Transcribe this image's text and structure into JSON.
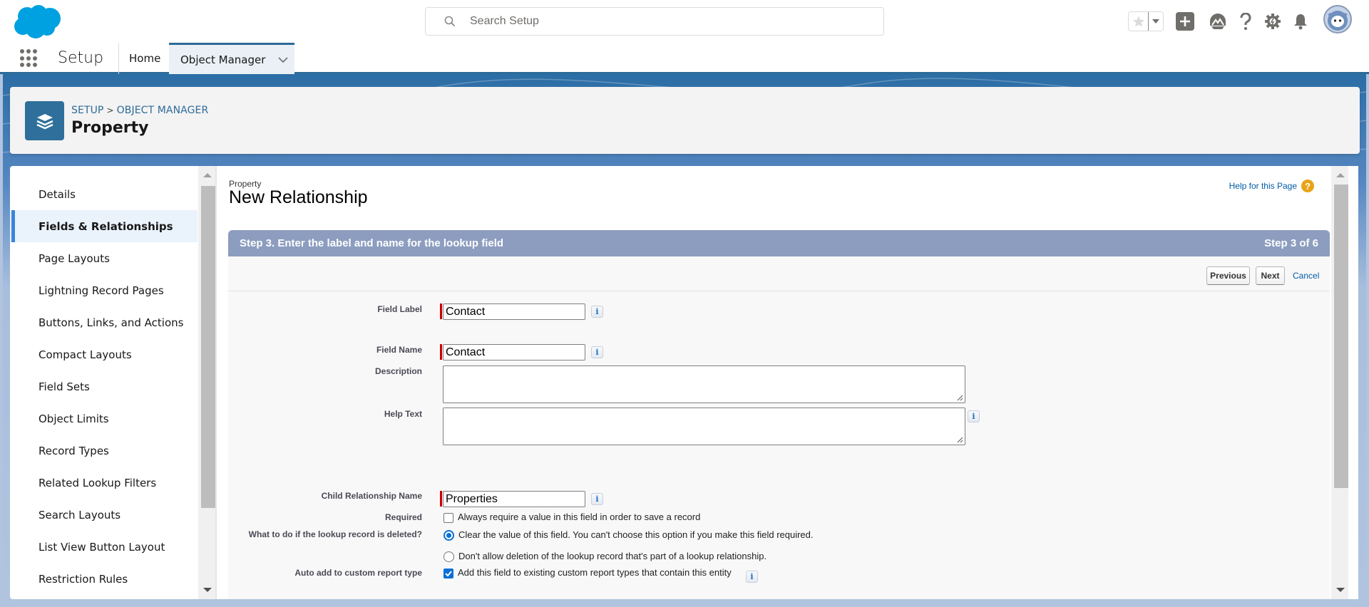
{
  "header": {
    "search_placeholder": "Search Setup",
    "icons": [
      "favorites-star-icon",
      "favorites-dropdown-icon",
      "global-actions-add-icon",
      "trailhead-icon",
      "help-icon",
      "setup-gear-icon",
      "notifications-bell-icon",
      "user-avatar"
    ]
  },
  "nav": {
    "app_name": "Setup",
    "tabs": [
      {
        "label": "Home",
        "active": false
      },
      {
        "label": "Object Manager",
        "active": true
      }
    ]
  },
  "object_header": {
    "breadcrumb": [
      "SETUP",
      "OBJECT MANAGER"
    ],
    "breadcrumb_separator": ">",
    "title": "Property",
    "icon": "layers-icon"
  },
  "sidebar": {
    "items": [
      {
        "label": "Details",
        "active": false
      },
      {
        "label": "Fields & Relationships",
        "active": true
      },
      {
        "label": "Page Layouts",
        "active": false
      },
      {
        "label": "Lightning Record Pages",
        "active": false
      },
      {
        "label": "Buttons, Links, and Actions",
        "active": false
      },
      {
        "label": "Compact Layouts",
        "active": false
      },
      {
        "label": "Field Sets",
        "active": false
      },
      {
        "label": "Object Limits",
        "active": false
      },
      {
        "label": "Record Types",
        "active": false
      },
      {
        "label": "Related Lookup Filters",
        "active": false
      },
      {
        "label": "Search Layouts",
        "active": false
      },
      {
        "label": "List View Button Layout",
        "active": false
      },
      {
        "label": "Restriction Rules",
        "active": false
      }
    ]
  },
  "page": {
    "type_label": "Property",
    "title": "New Relationship",
    "help_link": "Help for this Page",
    "step_title": "Step 3. Enter the label and name for the lookup field",
    "step_counter": "Step 3 of 6",
    "buttons": {
      "previous": "Previous",
      "next": "Next",
      "cancel": "Cancel"
    },
    "form": {
      "field_label": {
        "label": "Field Label",
        "value": "Contact"
      },
      "field_name": {
        "label": "Field Name",
        "value": "Contact"
      },
      "description": {
        "label": "Description",
        "value": ""
      },
      "help_text": {
        "label": "Help Text",
        "value": ""
      },
      "child_relationship_name": {
        "label": "Child Relationship Name",
        "value": "Properties"
      },
      "required": {
        "label": "Required",
        "option": "Always require a value in this field in order to save a record",
        "checked": false
      },
      "on_delete": {
        "label": "What to do if the lookup record is deleted?",
        "options": [
          {
            "label": "Clear the value of this field. You can't choose this option if you make this field required.",
            "selected": true
          },
          {
            "label": "Don't allow deletion of the lookup record that's part of a lookup relationship.",
            "selected": false
          }
        ]
      },
      "auto_add": {
        "label": "Auto add to custom report type",
        "option": "Add this field to existing custom report types that contain this entity",
        "checked": true
      }
    }
  },
  "colors": {
    "brand_blue": "#2c6b98",
    "step_bar": "#8c9dbf",
    "required_marker": "#cc0000",
    "link": "#015ba7",
    "help_orange": "#e8a317",
    "active_sidebar_accent": "#3a86d8"
  }
}
